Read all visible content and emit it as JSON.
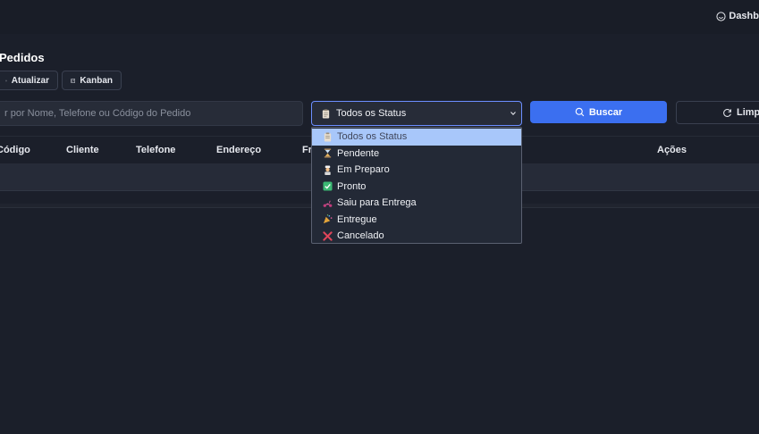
{
  "header": {
    "dashboard_label": "Dashb"
  },
  "page": {
    "title": "Pedidos"
  },
  "actions": {
    "refresh_label": "Atualizar",
    "kanban_label": "Kanban"
  },
  "filters": {
    "search_placeholder": "r por Nome, Telefone ou Código do Pedido",
    "status_selected": "Todos os Status",
    "search_button": "Buscar",
    "clear_button": "Limp"
  },
  "table": {
    "columns": [
      "Código",
      "Cliente",
      "Telefone",
      "Endereço",
      "Fr",
      "Ações"
    ]
  },
  "status_options": [
    {
      "label": "Todos os Status",
      "icon": "clipboard-icon"
    },
    {
      "label": "Pendente",
      "icon": "hourglass-icon"
    },
    {
      "label": "Em Preparo",
      "icon": "cook-icon"
    },
    {
      "label": "Pronto",
      "icon": "check-box-icon"
    },
    {
      "label": "Saiu para Entrega",
      "icon": "scooter-icon"
    },
    {
      "label": "Entregue",
      "icon": "party-icon"
    },
    {
      "label": "Cancelado",
      "icon": "cross-icon"
    }
  ],
  "colors": {
    "background": "#1b1f2a",
    "primary": "#3b6ff0",
    "select_border": "#6c8fff",
    "option_selected": "#a8c7fa",
    "cancel_red": "#e0455a",
    "check_green": "#3bb873"
  }
}
